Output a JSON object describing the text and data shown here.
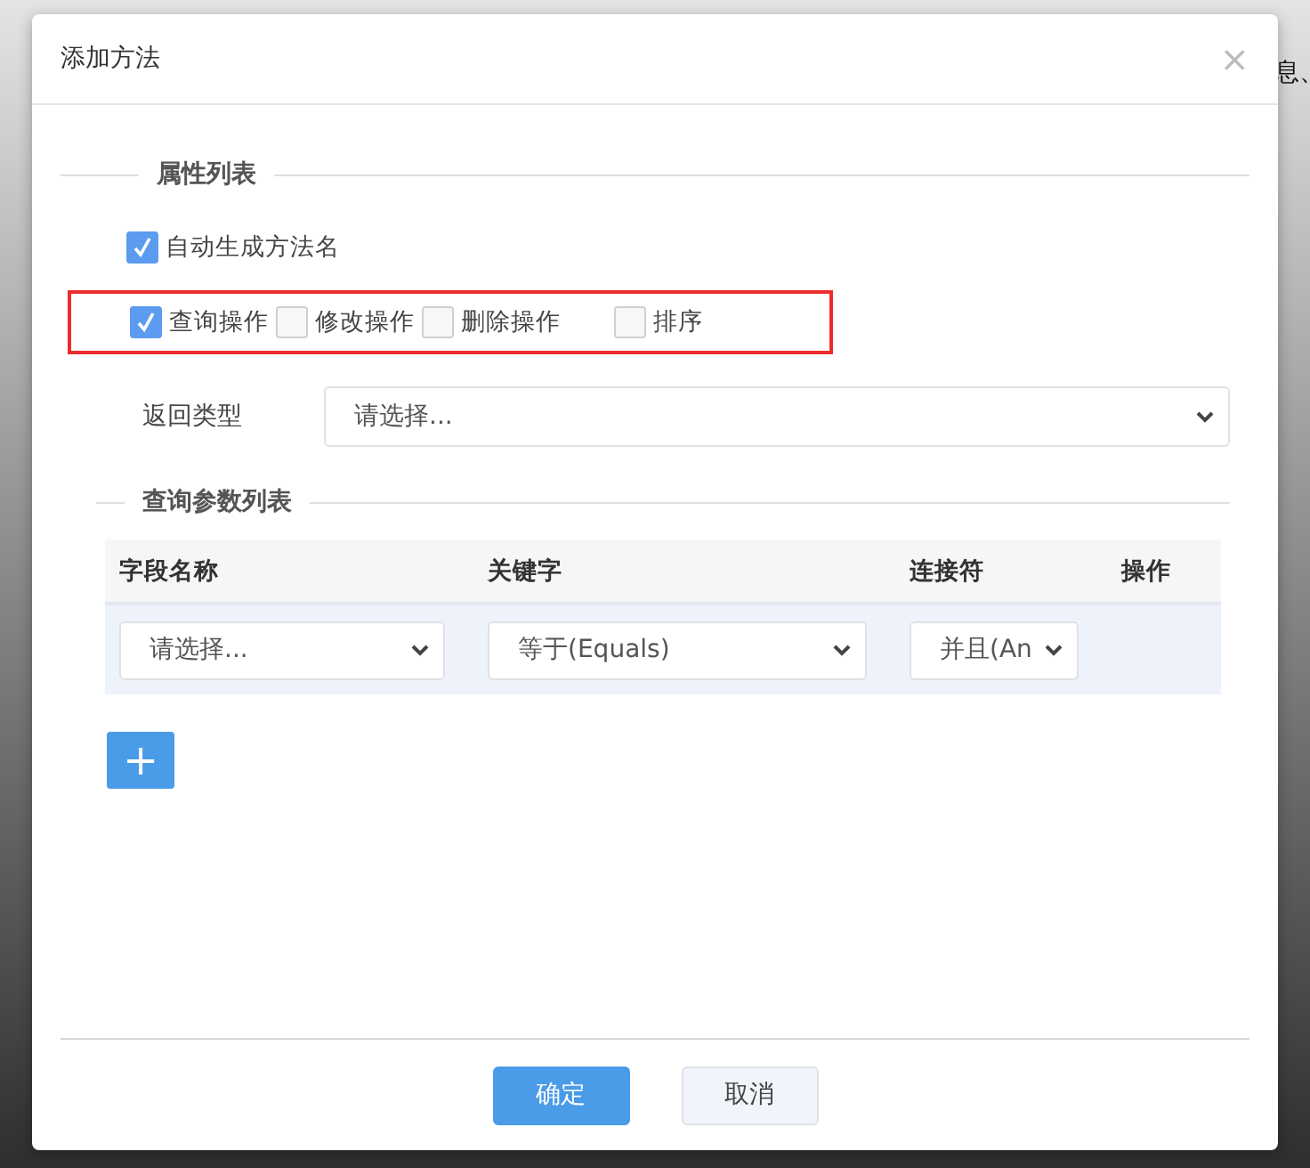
{
  "background_text": "息、",
  "dialog": {
    "title": "添加方法",
    "close": "×"
  },
  "attributes": {
    "legend": "属性列表",
    "auto_name": {
      "label": "自动生成方法名",
      "checked": true
    },
    "operations": {
      "highlighted": true,
      "items": [
        {
          "label": "查询操作",
          "checked": true
        },
        {
          "label": "修改操作",
          "checked": false
        },
        {
          "label": "删除操作",
          "checked": false
        },
        {
          "label": "排序",
          "checked": false
        }
      ]
    }
  },
  "return_type": {
    "label": "返回类型",
    "placeholder": "请选择..."
  },
  "query_params": {
    "legend": "查询参数列表",
    "columns": [
      "字段名称",
      "关键字",
      "连接符",
      "操作"
    ],
    "rows": [
      {
        "field": "请选择...",
        "keyword": "等于(Equals)",
        "connector": "并且(An"
      }
    ],
    "add_button": "+"
  },
  "buttons": [
    {
      "label": "确定",
      "kind": "primary"
    },
    {
      "label": "取消",
      "kind": "secondary"
    }
  ]
}
